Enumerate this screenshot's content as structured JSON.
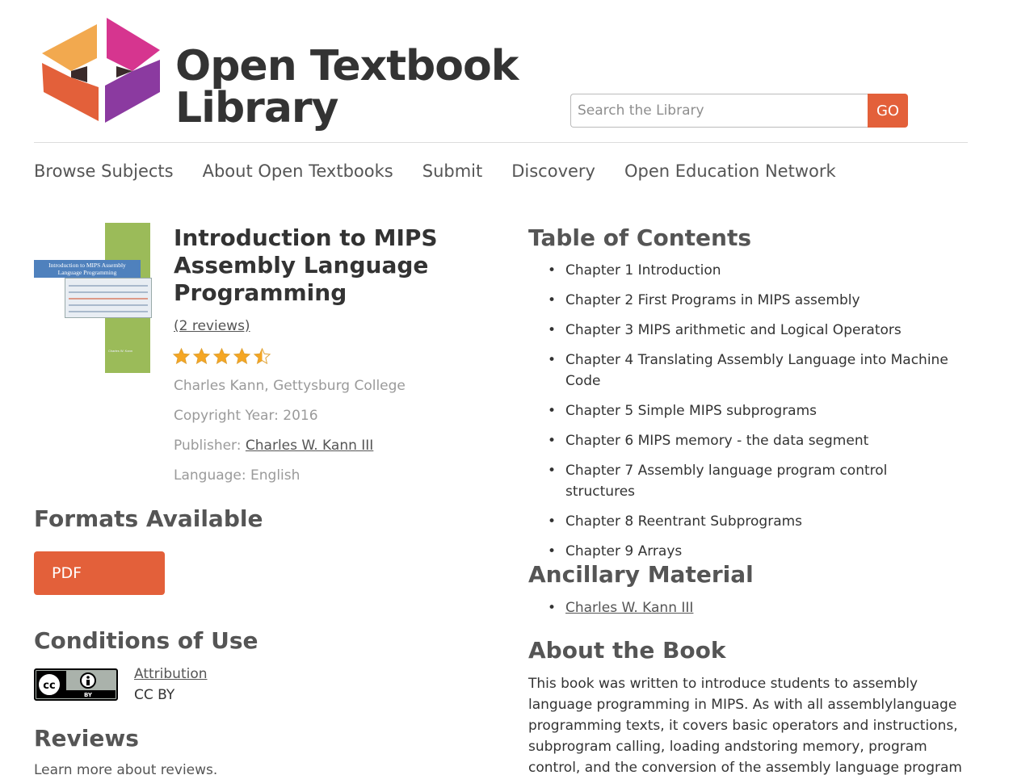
{
  "logo": {
    "line1": "Open Textbook",
    "line2": "Library",
    "colors": {
      "orange": "#f2a94f",
      "red": "#e3603a",
      "magenta": "#d6358f",
      "purple": "#8b3aa0"
    }
  },
  "search": {
    "placeholder": "Search the Library",
    "button": "GO",
    "accent": "#e3603a"
  },
  "nav": [
    "Browse Subjects",
    "About Open Textbooks",
    "Submit",
    "Discovery",
    "Open Education Network"
  ],
  "book": {
    "title": "Introduction to MIPS Assembly Language Programming",
    "cover_band": "Introduction to MIPS Assembly Language Programming",
    "cover_author": "Charles W. Kann",
    "reviews_link": "(2 reviews)",
    "rating": 4.5,
    "rating_max": 5,
    "author": "Charles Kann, Gettysburg College",
    "copyright": "Copyright Year: 2016",
    "publisher_label": "Publisher:",
    "publisher": "Charles W. Kann III",
    "language": "Language: English"
  },
  "formats": {
    "heading": "Formats Available",
    "pdf": "PDF"
  },
  "conditions": {
    "heading": "Conditions of Use",
    "license_link": "Attribution",
    "license_code": "CC BY",
    "badge_label": "BY"
  },
  "reviews": {
    "heading": "Reviews",
    "learn_more": "Learn more about reviews."
  },
  "toc": {
    "heading": "Table of Contents",
    "items": [
      "Chapter 1 Introduction",
      "Chapter 2 First Programs in MIPS assembly",
      "Chapter 3 MIPS arithmetic and Logical Operators",
      "Chapter 4 Translating Assembly Language into Machine Code",
      "Chapter 5 Simple MIPS subprograms",
      "Chapter 6 MIPS memory - the data segment",
      "Chapter 7 Assembly language program control structures",
      "Chapter 8 Reentrant Subprograms",
      "Chapter 9 Arrays"
    ]
  },
  "ancillary": {
    "heading": "Ancillary Material",
    "items": [
      "Charles W. Kann III"
    ]
  },
  "about": {
    "heading": "About the Book",
    "text": "This book was written to introduce students to assembly language programming in MIPS. As with all assemblylanguage programming texts, it covers basic operators and instructions, subprogram calling, loading andstoring memory, program control, and the conversion of the assembly language program"
  }
}
